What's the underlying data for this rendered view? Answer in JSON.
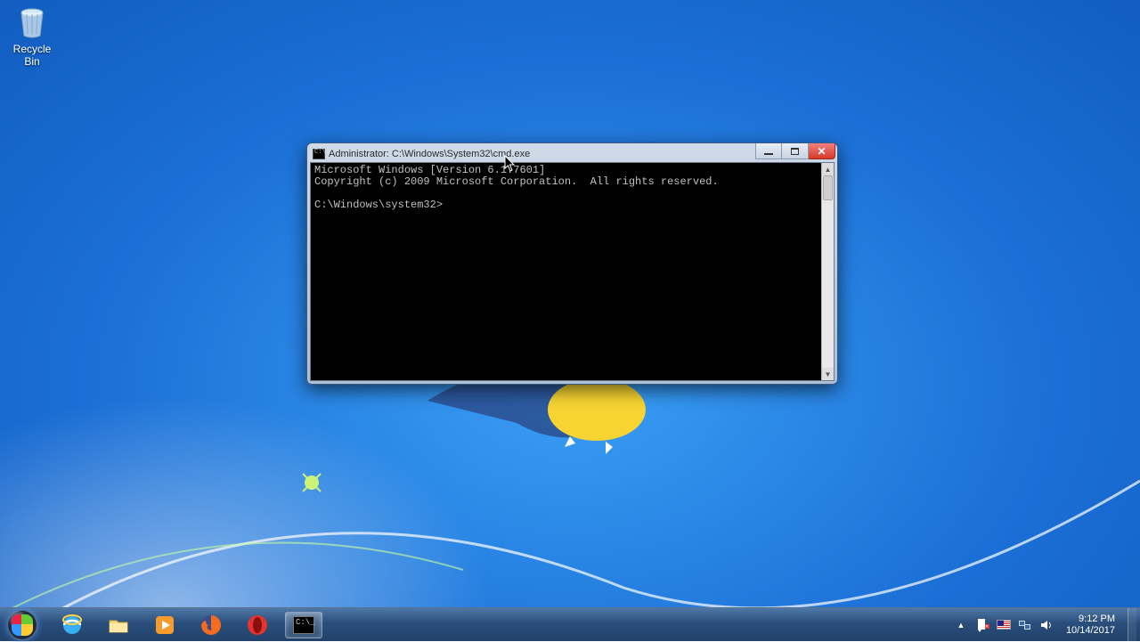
{
  "desktop_icons": [
    {
      "label": "Recycle Bin"
    }
  ],
  "window": {
    "title": "Administrator: C:\\Windows\\System32\\cmd.exe",
    "console": {
      "line1": "Microsoft Windows [Version 6.1.7601]",
      "line2": "Copyright (c) 2009 Microsoft Corporation.  All rights reserved.",
      "blank": "",
      "prompt": "C:\\Windows\\system32>"
    }
  },
  "taskbar": {
    "pinned": [
      {
        "name": "internet-explorer"
      },
      {
        "name": "file-explorer"
      },
      {
        "name": "windows-media-player"
      },
      {
        "name": "firefox"
      },
      {
        "name": "opera"
      },
      {
        "name": "cmd",
        "active": true
      }
    ]
  },
  "tray": {
    "time": "9:12 PM",
    "date": "10/14/2017"
  }
}
